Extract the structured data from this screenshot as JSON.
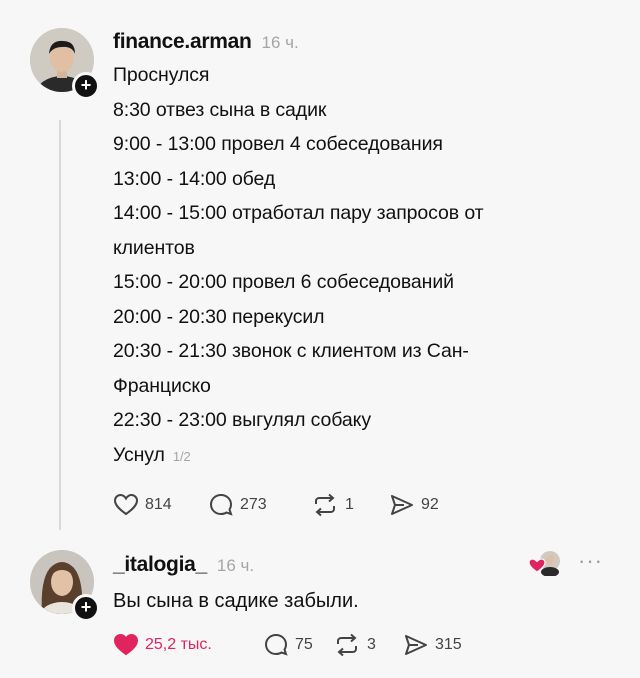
{
  "post": {
    "username": "finance.arman",
    "time": "16 ч.",
    "lines": [
      "Проснулся",
      "8:30 отвез сына в садик",
      "9:00 - 13:00 провел 4 собеседования",
      "13:00 - 14:00 обед",
      "14:00 - 15:00 отработал пару запросов от",
      "клиентов",
      "15:00 - 20:00 провел 6 собеседований",
      "20:00 - 20:30 перекусил",
      "20:30 - 21:30 звонок с клиентом из Сан-",
      "Франциско",
      "22:30 - 23:00 выгулял собаку",
      "Уснул"
    ],
    "page_indicator": "1/2",
    "likes": "814",
    "comments": "273",
    "reposts": "1",
    "shares": "92"
  },
  "reply": {
    "username": "_italogia_",
    "time": "16 ч.",
    "text": "Вы сына в садике забыли.",
    "likes": "25,2 тыс.",
    "comments": "75",
    "reposts": "3",
    "shares": "315",
    "more": "···"
  },
  "colors": {
    "like_active": "#e0245e",
    "muted": "#a5a5a5",
    "background": "#f7f7f7"
  }
}
